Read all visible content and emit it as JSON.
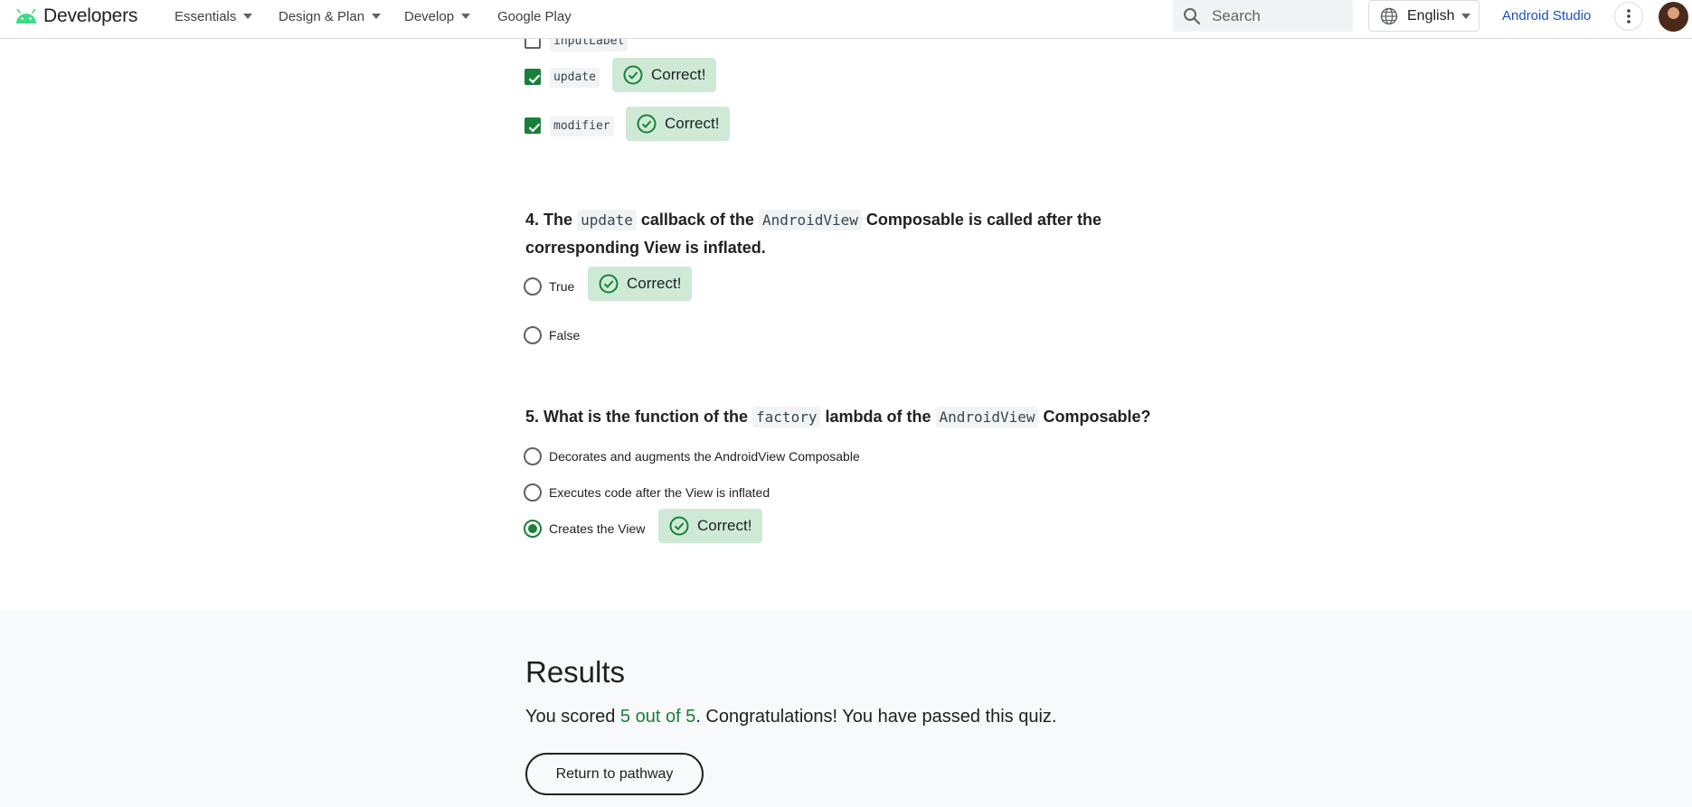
{
  "header": {
    "brand": "Developers",
    "nav": [
      {
        "label": "Essentials",
        "has_dropdown": true
      },
      {
        "label": "Design & Plan",
        "has_dropdown": true
      },
      {
        "label": "Develop",
        "has_dropdown": true
      },
      {
        "label": "Google Play",
        "has_dropdown": false
      }
    ],
    "search_placeholder": "Search",
    "language": "English",
    "cta": "Android Studio"
  },
  "question3": {
    "options": [
      {
        "code": "inputLabel",
        "checked": false
      },
      {
        "code": "update",
        "checked": true,
        "feedback": "Correct!"
      },
      {
        "code": "modifier",
        "checked": true,
        "feedback": "Correct!"
      }
    ]
  },
  "question4": {
    "number": "4.",
    "text_1": "The",
    "code_1": "update",
    "text_2": "callback of the",
    "code_2": "AndroidView",
    "text_3": "Composable is called after the",
    "text_4": "corresponding View is inflated.",
    "options": [
      {
        "label": "True",
        "selected": true,
        "feedback": "Correct!"
      },
      {
        "label": "False",
        "selected": false
      }
    ]
  },
  "question5": {
    "number": "5.",
    "text_1": "What is the function of the",
    "code_1": "factory",
    "text_2": "lambda of the",
    "code_2": "AndroidView",
    "text_3": "Composable?",
    "options": [
      {
        "label": "Decorates and augments the AndroidView Composable",
        "selected": false
      },
      {
        "label": "Executes code after the View is inflated",
        "selected": false
      },
      {
        "label": "Creates the View",
        "selected": true,
        "feedback": "Correct!"
      }
    ]
  },
  "results": {
    "title": "Results",
    "score_prefix": "You scored",
    "score": "5 out of 5",
    "score_suffix": ". Congratulations! You have passed this quiz.",
    "button": "Return to pathway"
  },
  "colors": {
    "accent_green": "#188038",
    "correct_bg": "#ceead6",
    "link_blue": "#1a4ecc"
  }
}
